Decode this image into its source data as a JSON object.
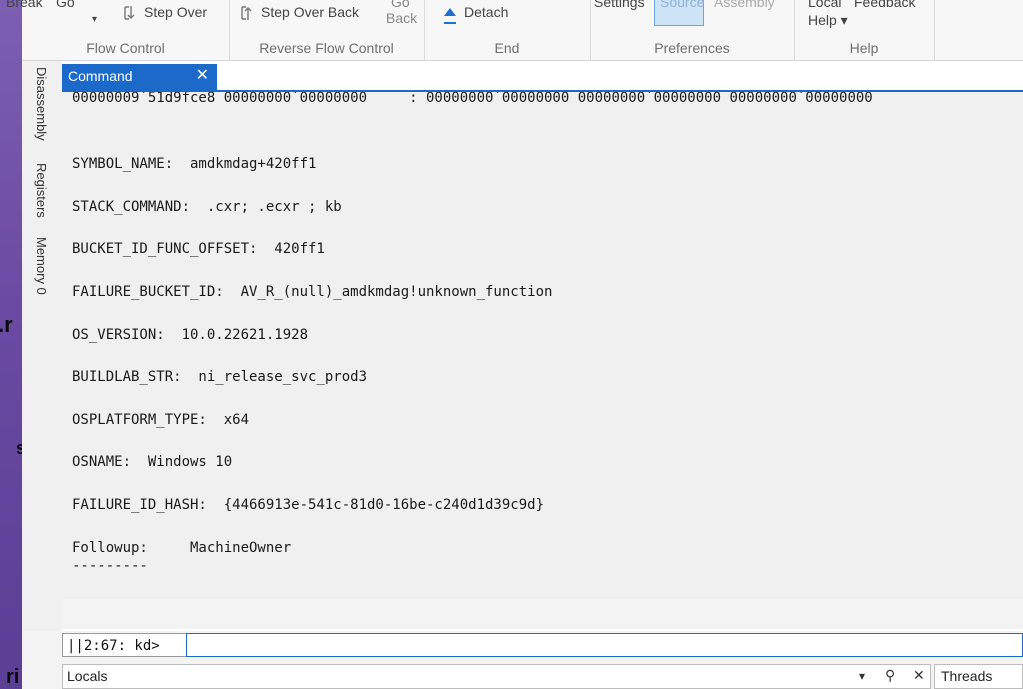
{
  "ribbon": {
    "break_label": "Break",
    "go_label": "Go",
    "step_over_label": "Step Over",
    "step_over_back_label": "Step Over Back",
    "go_back_label_top": "Go",
    "go_back_label_bottom": "Back",
    "detach_label": "Detach",
    "settings_label": "Settings",
    "source_label": "Source",
    "assembly_label": "Assembly",
    "local_label": "Local",
    "feedback_label": "Feedback",
    "help_label": "Help ▾",
    "groups": {
      "flow_control": "Flow Control",
      "reverse_flow_control": "Reverse Flow Control",
      "end": "End",
      "preferences": "Preferences",
      "help": "Help"
    }
  },
  "side_tabs": [
    "Disassembly",
    "Registers",
    "Memory 0"
  ],
  "command_window": {
    "tab_label": "Command",
    "close_glyph": "✕",
    "lines": [
      "00000009`51d9fce8 00000000`00000000     : 00000000`00000000 00000000`00000000 00000000`00000000",
      "SYMBOL_NAME:  amdkmdag+420ff1",
      "STACK_COMMAND:  .cxr; .ecxr ; kb",
      "BUCKET_ID_FUNC_OFFSET:  420ff1",
      "FAILURE_BUCKET_ID:  AV_R_(null)_amdkmdag!unknown_function",
      "OS_VERSION:  10.0.22621.1928",
      "BUILDLAB_STR:  ni_release_svc_prod3",
      "OSPLATFORM_TYPE:  x64",
      "OSNAME:  Windows 10",
      "FAILURE_ID_HASH:  {4466913e-541c-81d0-16be-c240d1d39c9d}",
      "Followup:     MachineOwner",
      "---------"
    ],
    "prompt": "||2:67: kd>",
    "input_value": ""
  },
  "locals_panel": {
    "title": "Locals",
    "dropdown_glyph": "▾",
    "pin_glyph": "⚲",
    "close_glyph": "✕"
  },
  "threads_panel": {
    "title": "Threads"
  },
  "desktop_fragments": [
    ".r",
    "s",
    "ri"
  ]
}
